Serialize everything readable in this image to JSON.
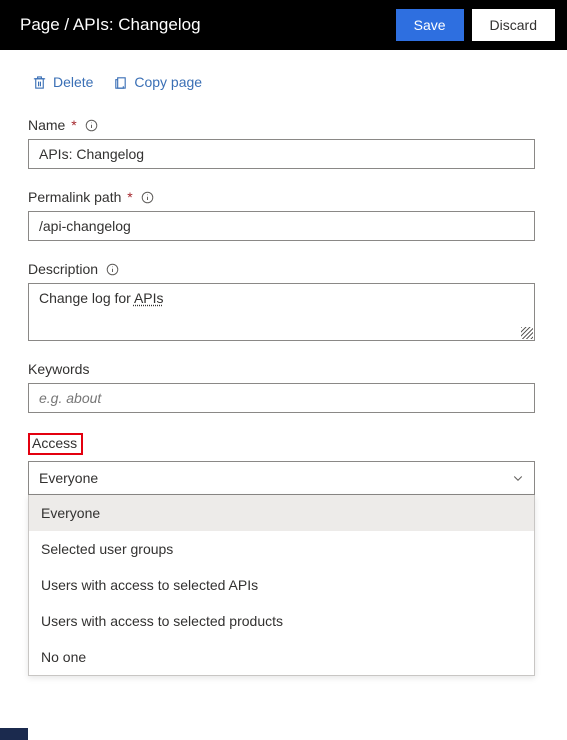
{
  "header": {
    "title": "Page / APIs: Changelog",
    "save_label": "Save",
    "discard_label": "Discard"
  },
  "toolbar": {
    "delete_label": "Delete",
    "copy_label": "Copy page"
  },
  "fields": {
    "name": {
      "label": "Name",
      "value": "APIs: Changelog"
    },
    "permalink": {
      "label": "Permalink path",
      "value": "/api-changelog"
    },
    "description": {
      "label": "Description",
      "value_prefix": "Change log for ",
      "value_link": "APIs"
    },
    "keywords": {
      "label": "Keywords",
      "placeholder": "e.g. about"
    },
    "access": {
      "label": "Access",
      "selected": "Everyone",
      "options": [
        "Everyone",
        "Selected user groups",
        "Users with access to selected APIs",
        "Users with access to selected products",
        "No one"
      ]
    }
  }
}
